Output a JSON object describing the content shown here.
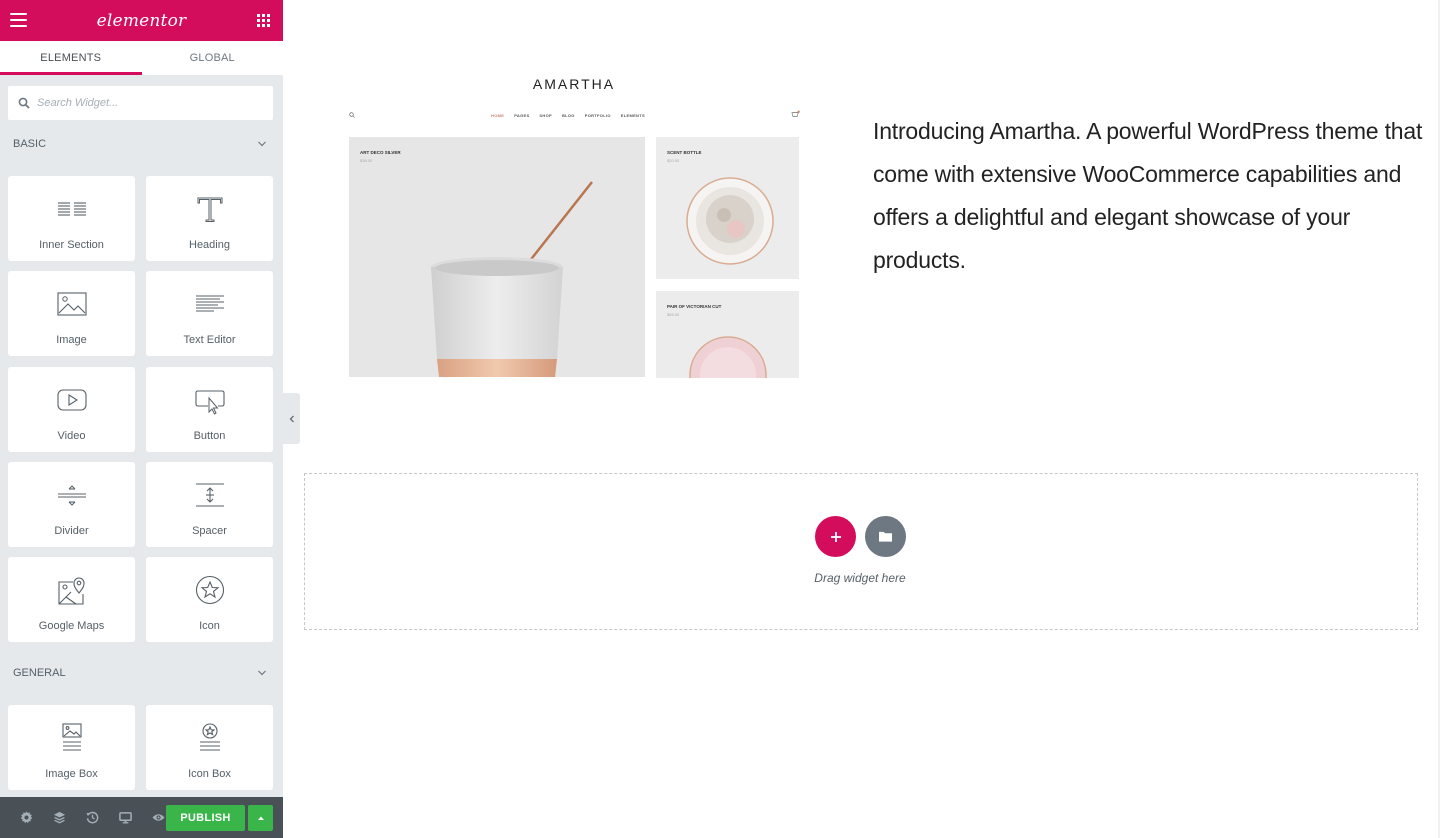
{
  "app": {
    "logo_text": "elementor",
    "brand_color": "#d30c5c"
  },
  "tabs": [
    {
      "label": "ELEMENTS",
      "active": true
    },
    {
      "label": "GLOBAL",
      "active": false
    }
  ],
  "search": {
    "placeholder": "Search Widget..."
  },
  "sections": {
    "basic": {
      "label": "BASIC"
    },
    "general": {
      "label": "GENERAL"
    }
  },
  "widgets": {
    "inner_section": {
      "label": "Inner Section",
      "icon": "inner-section-icon"
    },
    "heading": {
      "label": "Heading",
      "icon": "heading-icon"
    },
    "image": {
      "label": "Image",
      "icon": "image-icon"
    },
    "text_editor": {
      "label": "Text Editor",
      "icon": "text-editor-icon"
    },
    "video": {
      "label": "Video",
      "icon": "video-icon"
    },
    "button": {
      "label": "Button",
      "icon": "button-icon"
    },
    "divider": {
      "label": "Divider",
      "icon": "divider-icon"
    },
    "spacer": {
      "label": "Spacer",
      "icon": "spacer-icon"
    },
    "google_maps": {
      "label": "Google Maps",
      "icon": "google-maps-icon"
    },
    "icon": {
      "label": "Icon",
      "icon": "star-icon"
    },
    "image_box": {
      "label": "Image Box",
      "icon": "image-box-icon"
    },
    "icon_box": {
      "label": "Icon Box",
      "icon": "icon-box-icon"
    }
  },
  "footer": {
    "publish_label": "PUBLISH",
    "publish_color": "#39b54a"
  },
  "canvas": {
    "mockup": {
      "brand": "AMARTHA",
      "nav": [
        "HOME",
        "PAGES",
        "SHOP",
        "BLOG",
        "PORTFOLIO",
        "ELEMENTS"
      ],
      "products": [
        {
          "title": "ART DECO SILVER",
          "price": "$38.00"
        },
        {
          "title": "SCENT BOTTLE",
          "price": "$20.00"
        },
        {
          "title": "PAIR OF VICTORIAN CUT",
          "price": "$55.00"
        }
      ]
    },
    "intro_text": "Introducing Amartha. A powerful WordPress theme that come with extensive WooCommerce capabilities and offers a delightful and elegant showcase of your products.",
    "drag_text": "Drag widget here"
  }
}
